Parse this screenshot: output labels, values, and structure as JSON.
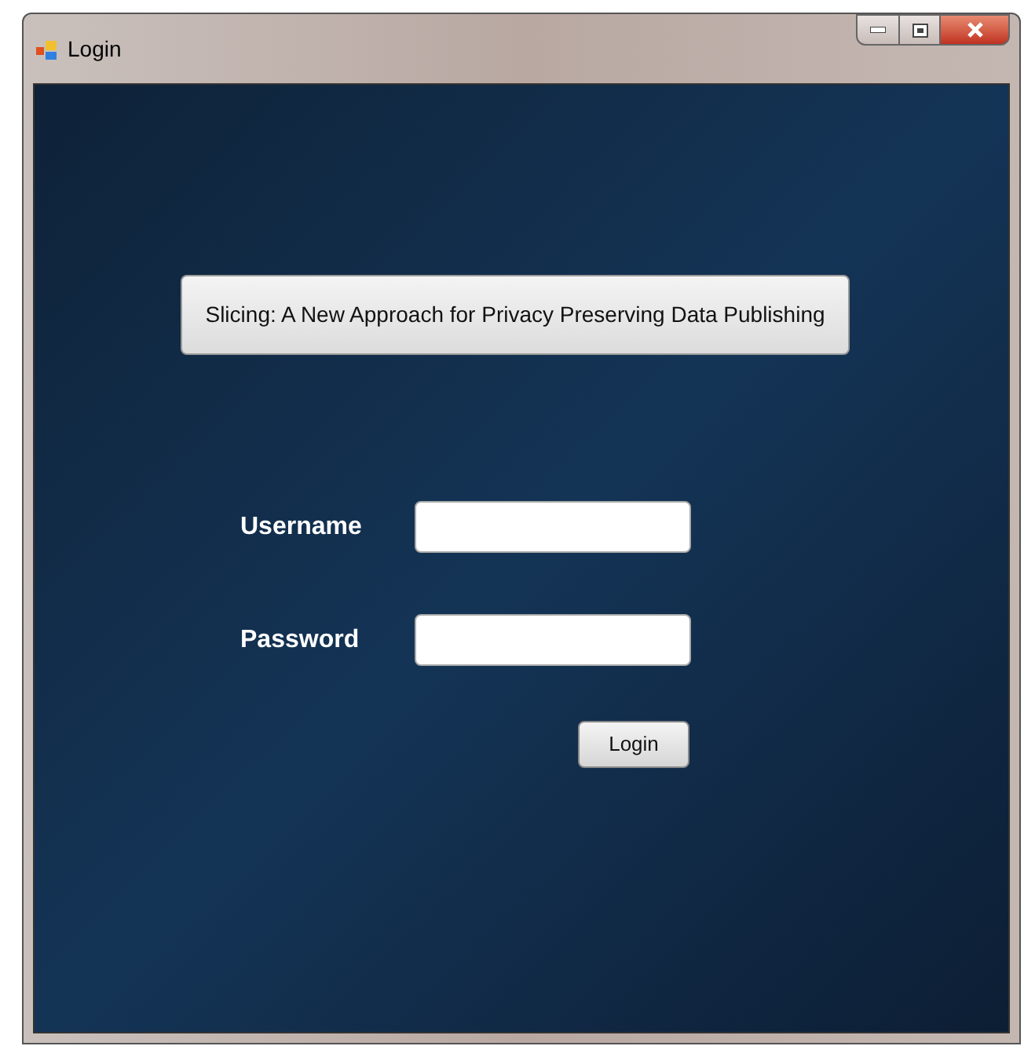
{
  "window": {
    "title": "Login"
  },
  "heading_button": {
    "label": "Slicing: A New Approach for Privacy Preserving Data Publishing"
  },
  "fields": [
    {
      "label": "Username"
    },
    {
      "label": "Password"
    }
  ],
  "login_button": {
    "label": "Login"
  }
}
